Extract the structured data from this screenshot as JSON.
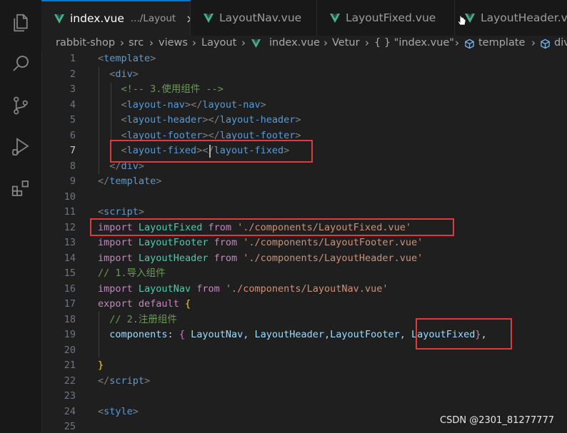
{
  "tabs": [
    {
      "label": "index.vue",
      "description": ".../Layout",
      "close": "×",
      "active": true
    },
    {
      "label": "LayoutNav.vue",
      "active": false
    },
    {
      "label": "LayoutFixed.vue",
      "active": false
    },
    {
      "label": "LayoutHeader.vue",
      "active": false
    }
  ],
  "breadcrumb": [
    "rabbit-shop",
    "src",
    "views",
    "Layout",
    "index.vue",
    "Vetur",
    "{ } \"index.vue\"",
    "template",
    "div"
  ],
  "activity_icons": [
    "explorer-icon",
    "search-icon",
    "source-control-icon",
    "run-debug-icon",
    "extensions-icon"
  ],
  "colors": {
    "accent": "#0078d4",
    "highlight_box": "#e0393e",
    "vue_green": "#41b883"
  },
  "code": {
    "line_numbers": [
      "1",
      "2",
      "3",
      "4",
      "5",
      "6",
      "7",
      "8",
      "9",
      "10",
      "11",
      "12",
      "13",
      "14",
      "15",
      "16",
      "17",
      "18",
      "19",
      "20",
      "21",
      "22",
      "23",
      "24",
      "25"
    ],
    "current_line": "7",
    "lines": {
      "l1": [
        "<",
        "template",
        ">"
      ],
      "l2": [
        "<",
        "div",
        ">"
      ],
      "l3": "<!-- 3.使用组件 -->",
      "l4": [
        "<",
        "layout-nav",
        "></",
        "layout-nav",
        ">"
      ],
      "l5": [
        "<",
        "layout-header",
        "></",
        "layout-header",
        ">"
      ],
      "l6": [
        "<",
        "layout-footer",
        "></",
        "layout-footer",
        ">"
      ],
      "l7": [
        "<",
        "layout-fixed",
        ">",
        "</",
        "layout-fixed",
        ">"
      ],
      "l8": [
        "</",
        "div",
        ">"
      ],
      "l9": [
        "</",
        "template",
        ">"
      ],
      "l11": [
        "<",
        "script",
        ">"
      ],
      "l12": [
        "import",
        "LayoutFixed",
        "from",
        "'./components/LayoutFixed.vue'"
      ],
      "l13": [
        "import",
        "LayoutFooter",
        "from",
        "'./components/LayoutFooter.vue'"
      ],
      "l14": [
        "import",
        "LayoutHeader",
        "from",
        "'./components/LayoutHeader.vue'"
      ],
      "l15": "// 1.导入组件",
      "l16": [
        "import",
        "LayoutNav",
        "from",
        "'./components/LayoutNav.vue'"
      ],
      "l17": [
        "export",
        "default",
        "{"
      ],
      "l18": "// 2.注册组件",
      "l19": [
        "components",
        ":",
        "{",
        "LayoutNav, LayoutHeader,LayoutFooter, LayoutFixed",
        "}",
        ","
      ],
      "l21": "}",
      "l22": [
        "</",
        "script",
        ">"
      ],
      "l24": [
        "<",
        "style",
        ">"
      ]
    }
  },
  "watermark": "CSDN @2301_81277777"
}
